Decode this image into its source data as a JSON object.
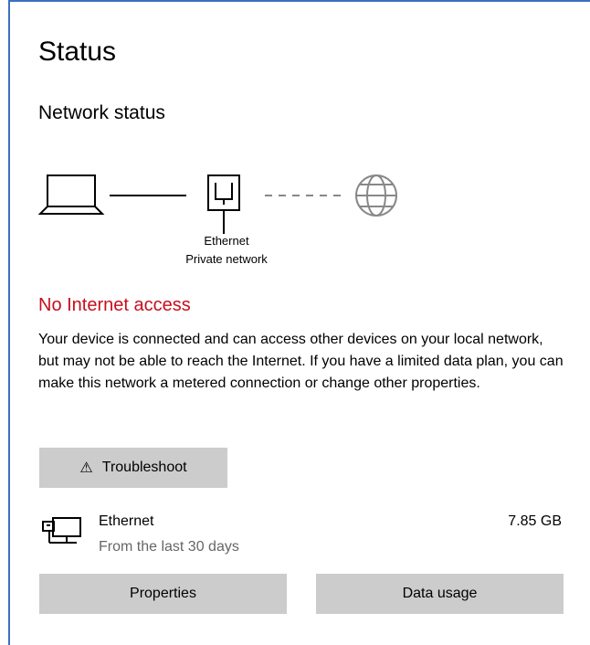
{
  "page": {
    "title": "Status"
  },
  "network": {
    "section_title": "Network status",
    "connection_name": "Ethernet",
    "connection_type": "Private network",
    "status_heading": "No Internet access",
    "status_description": "Your device is connected and can access other devices on your local network, but may not be able to reach the Internet. If you have a limited data plan, you can make this network a metered connection or change other properties.",
    "status_color": "#c50f1f"
  },
  "actions": {
    "troubleshoot_label": "Troubleshoot",
    "troubleshoot_icon": "warning-icon"
  },
  "usage": {
    "adapter_name": "Ethernet",
    "period": "From the last 30 days",
    "amount": "7.85 GB",
    "adapter_icon": "ethernet-adapter-icon"
  },
  "buttons": {
    "properties_label": "Properties",
    "data_usage_label": "Data usage"
  },
  "colors": {
    "frame_accent": "#3b6fc0",
    "button_bg": "#cccccc"
  }
}
